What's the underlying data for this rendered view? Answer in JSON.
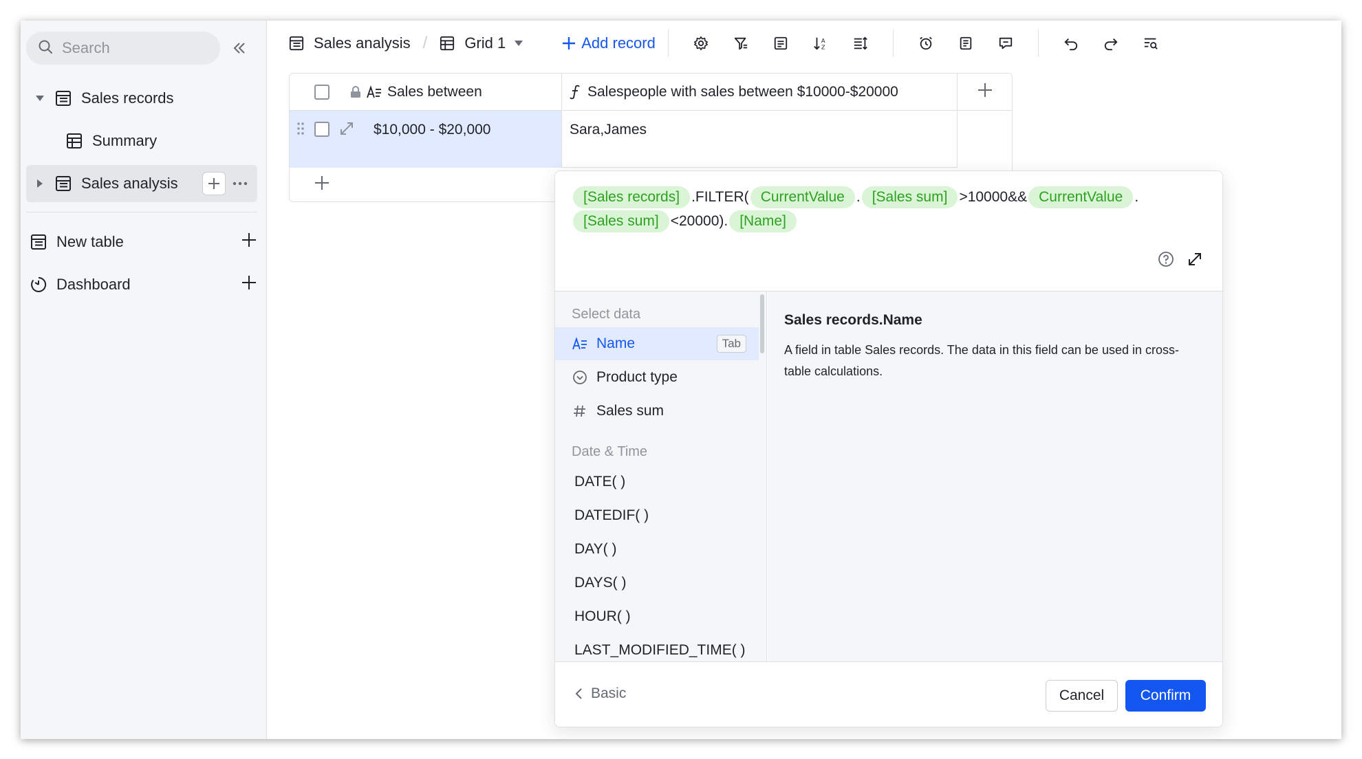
{
  "sidebar": {
    "search_placeholder": "Search",
    "tree": [
      {
        "label": "Sales records"
      },
      {
        "label": "Summary"
      },
      {
        "label": "Sales analysis"
      }
    ],
    "sections": [
      {
        "label": "New table"
      },
      {
        "label": "Dashboard"
      }
    ]
  },
  "toolbar": {
    "table_name": "Sales analysis",
    "separator": "/",
    "view_name": "Grid 1",
    "add_record": "Add record"
  },
  "grid": {
    "columns": [
      {
        "label": "Sales between"
      },
      {
        "label": "Salespeople with sales between $10000-$20000"
      }
    ],
    "rows": [
      {
        "sales_between": "$10,000 - $20,000",
        "salespeople": "Sara,James"
      }
    ]
  },
  "formula": {
    "tokens": [
      {
        "type": "chip",
        "text": "[Sales records]"
      },
      {
        "type": "text",
        "text": ".FILTER("
      },
      {
        "type": "chip",
        "text": "CurrentValue"
      },
      {
        "type": "text",
        "text": "."
      },
      {
        "type": "chip",
        "text": "[Sales sum]"
      },
      {
        "type": "text",
        "text": ">10000&&"
      },
      {
        "type": "chip",
        "text": "CurrentValue"
      },
      {
        "type": "text",
        "text": "."
      },
      {
        "type": "chip",
        "text": "[Sales sum]"
      },
      {
        "type": "text",
        "text": "<20000)."
      },
      {
        "type": "chip",
        "text": "[Name]"
      }
    ]
  },
  "picker": {
    "select_data_title": "Select data",
    "fields": [
      {
        "label": "Name",
        "icon": "text-field-icon",
        "hint": "Tab"
      },
      {
        "label": "Product type",
        "icon": "single-select-icon"
      },
      {
        "label": "Sales sum",
        "icon": "number-field-icon"
      }
    ],
    "datetime_title": "Date & Time",
    "functions": [
      "DATE( )",
      "DATEDIF( )",
      "DAY( )",
      "DAYS( )",
      "HOUR( )",
      "LAST_MODIFIED_TIME( )"
    ],
    "description_title": "Sales records.Name",
    "description_body": "A field in table Sales records. The data in this field can be used in cross-table calculations."
  },
  "footer": {
    "basic_label": "Basic",
    "cancel_label": "Cancel",
    "confirm_label": "Confirm"
  },
  "colors": {
    "accent": "#1456f0",
    "chip_bg": "#d9f5d6",
    "chip_text": "#2ea121",
    "selected_row": "#e1eaff"
  }
}
